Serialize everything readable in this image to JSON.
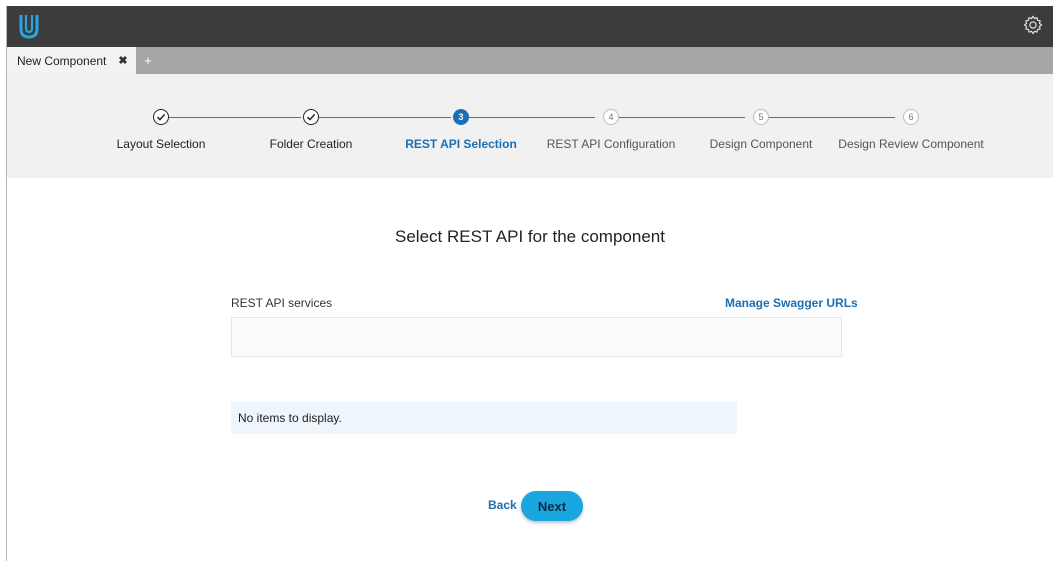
{
  "colors": {
    "topbar": "#3c3c3c",
    "tabbar": "#a6a6a6",
    "stepper_bg": "#f1f1f1",
    "accent_blue": "#1c6fb4",
    "next_button": "#1aa6df",
    "empty_box_bg": "#eef5fb"
  },
  "header": {
    "logo_icon": "u-logo-icon",
    "settings_icon": "gear-icon"
  },
  "tabs": {
    "items": [
      {
        "label": "New Component",
        "close_glyph": "✖"
      }
    ],
    "add_glyph": "+"
  },
  "stepper": {
    "steps": [
      {
        "label": "Layout Selection",
        "marker": "",
        "state": "done"
      },
      {
        "label": "Folder Creation",
        "marker": "",
        "state": "done"
      },
      {
        "label": "REST API Selection",
        "marker": "3",
        "state": "active"
      },
      {
        "label": "REST API Configuration",
        "marker": "4",
        "state": "pending"
      },
      {
        "label": "Design Component",
        "marker": "5",
        "state": "pending"
      },
      {
        "label": "Design Review Component",
        "marker": "6",
        "state": "pending"
      }
    ]
  },
  "main": {
    "title": "Select REST API for the component",
    "services_label": "REST API services",
    "manage_link": "Manage Swagger URLs",
    "services_value": "",
    "empty_message": "No items to display.",
    "back_label": "Back",
    "next_label": "Next"
  }
}
